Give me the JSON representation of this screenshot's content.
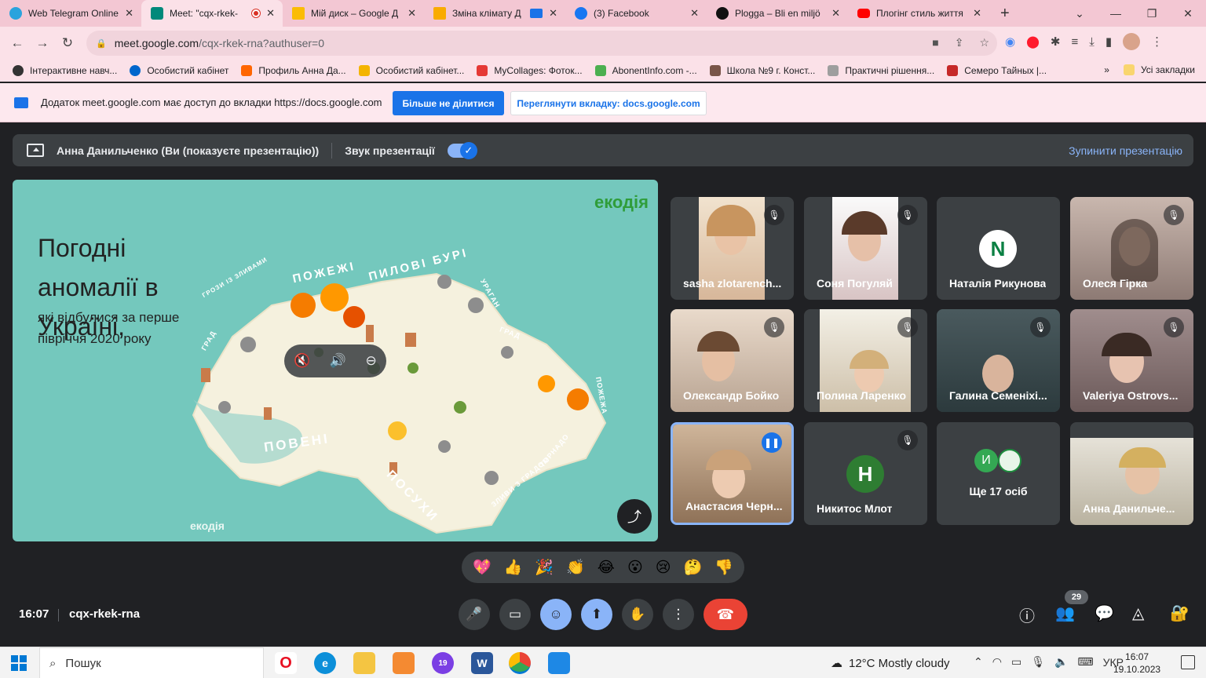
{
  "browser": {
    "tabs": [
      {
        "title": "Web Telegram Online",
        "color": "#2aa3dd"
      },
      {
        "title": "Meet: \"cqx-rkek-",
        "color": "#00897b",
        "active": true
      },
      {
        "title": "Мій диск – Google Д",
        "color": "#fbbc04"
      },
      {
        "title": "Зміна клімату Д",
        "color": "#f9ab00"
      },
      {
        "title": "(3) Facebook",
        "color": "#1877f2"
      },
      {
        "title": "Plogga – Bli en miljö",
        "color": "#111111"
      },
      {
        "title": "Плогінг стиль життя",
        "color": "#ff0000"
      }
    ],
    "new_tab": "+",
    "address": {
      "host": "meet.google.com",
      "rest": "/cqx-rkek-rna?authuser=0"
    },
    "bookmarks": [
      {
        "label": "Інтерактивне навч...",
        "color": "#333333"
      },
      {
        "label": "Особистий кабінет",
        "color": "#0066cc"
      },
      {
        "label": "Профиль Анна Да...",
        "color": "#ff6600"
      },
      {
        "label": "Особистий кабінет...",
        "color": "#f4b400"
      },
      {
        "label": "MyCollages: Фоток...",
        "color": "#e53935"
      },
      {
        "label": "AbonentInfo.com -...",
        "color": "#4caf50"
      },
      {
        "label": "Школа №9 г. Конст...",
        "color": "#795548"
      },
      {
        "label": "Практичні рішення...",
        "color": "#9e9e9e"
      },
      {
        "label": "Семеро Тайных |...",
        "color": "#c62828"
      }
    ],
    "bookmarks_more": "»",
    "all_bookmarks": "Усі закладки"
  },
  "infobar": {
    "text": "Додаток meet.google.com має доступ до вкладки https://docs.google.com",
    "stop_sharing": "Більше не ділитися",
    "view_tab": "Переглянути вкладку: docs.google.com"
  },
  "presenting": {
    "label": "Анна Данильченко (Ви (показуєте презентацію))",
    "audio_label": "Звук презентації",
    "stop": "Зупинити презентацію"
  },
  "slide": {
    "logo": "екодія",
    "title": "Погодні аномалії в Україні,",
    "subtitle": "які відбулися за перше півріччя 2020 року",
    "labels": [
      "ПОЖЕЖІ",
      "ПИЛОВІ БУРІ",
      "ПОВЕНІ",
      "ПОСУХИ"
    ],
    "small_labels": [
      "ГРОЗИ ІЗ ЗЛИВАМИ",
      "ГРАД",
      "УРАГАН",
      "ГРАД",
      "ЗЛИВИ З ГРАДОМ",
      "ТОРНАДО",
      "ПОЖЕЖА"
    ]
  },
  "participants": [
    {
      "name": "sasha zlotarench...",
      "muted": true,
      "type": "video"
    },
    {
      "name": "Соня Погуляй",
      "muted": true,
      "type": "video"
    },
    {
      "name": "Наталія Рикунова",
      "muted": false,
      "type": "avatar",
      "letter": "N"
    },
    {
      "name": "Олеся Гірка",
      "muted": true,
      "type": "video"
    },
    {
      "name": "Олександр Бойко",
      "muted": true,
      "type": "video"
    },
    {
      "name": "Полина Ларенко",
      "muted": true,
      "type": "video"
    },
    {
      "name": "Галина Семеніхі...",
      "muted": true,
      "type": "video"
    },
    {
      "name": "Valeriya Ostrovs...",
      "muted": true,
      "type": "video"
    },
    {
      "name": "Анастасия Черн...",
      "muted": false,
      "type": "video",
      "speaking": true
    },
    {
      "name": "Никитос Млот",
      "muted": true,
      "type": "avatar",
      "letter": "Н"
    },
    {
      "name": "Ще 17 осіб",
      "muted": false,
      "type": "more",
      "letter": "И"
    },
    {
      "name": "Анна Данильче...",
      "muted": false,
      "type": "video"
    }
  ],
  "reactions": [
    "💖",
    "👍",
    "🎉",
    "👏",
    "😂",
    "😮",
    "😢",
    "🤔",
    "👎"
  ],
  "bottom": {
    "time": "16:07",
    "meeting_code": "cqx-rkek-rna",
    "people_count": "29"
  },
  "taskbar": {
    "search": "Пошук",
    "weather": "12°C  Mostly cloudy",
    "lang": "УКР",
    "time": "16:07",
    "date": "19.10.2023",
    "calendar_badge": "19"
  }
}
